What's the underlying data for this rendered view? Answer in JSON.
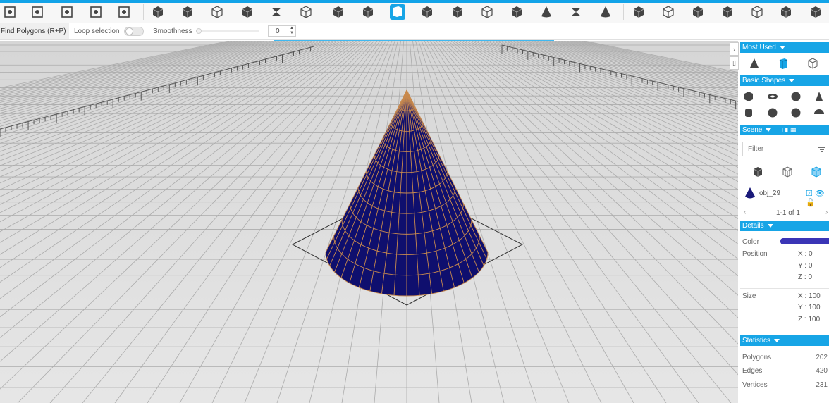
{
  "subbar": {
    "find_label": "Find Polygons (R+P)",
    "loop_label": "Loop selection",
    "smooth_label": "Smoothness",
    "smooth_value": "0"
  },
  "panel": {
    "most_used": "Most Used",
    "basic_shapes": "Basic Shapes",
    "scene": "Scene",
    "filter_placeholder": "Filter",
    "object_name": "obj_29",
    "pager": "1-1 of 1",
    "details": "Details",
    "color_label": "Color",
    "color_value": "#3a35b6",
    "position_label": "Position",
    "position": {
      "x": "X : 0",
      "y": "Y : 0",
      "z": "Z : 0"
    },
    "size_label": "Size",
    "size": {
      "x": "X : 100",
      "y": "Y : 100",
      "z": "Z : 100"
    },
    "statistics": "Statistics",
    "polygons_label": "Polygons",
    "polygons_value": "202",
    "edges_label": "Edges",
    "edges_value": "420",
    "vertices_label": "Vertices",
    "vertices_value": "231"
  },
  "colors": {
    "accent": "#17a5e6",
    "mesh": "#0f0f6e",
    "wire": "#c98a4e"
  }
}
